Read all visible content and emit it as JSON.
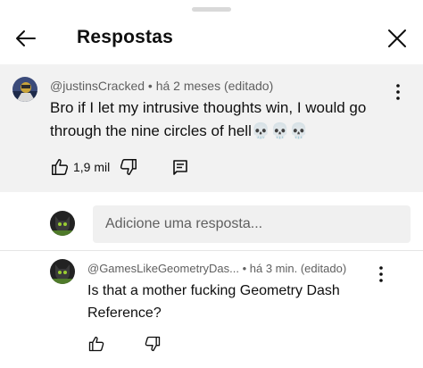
{
  "header": {
    "title": "Respostas"
  },
  "parent_comment": {
    "author": "@justinsCracked",
    "meta": " • há 2 meses (editado)",
    "text": "Bro if I let my intrusive thoughts win, I would go through the nine circles of hell💀💀💀",
    "likes": "1,9 mil"
  },
  "reply_input": {
    "placeholder": "Adicione uma resposta..."
  },
  "reply": {
    "author": "@GamesLikeGeometryDas...",
    "meta": " • há 3 min. (editado)",
    "text": "Is that a mother fucking Geometry Dash Reference?"
  },
  "icons": {
    "back": "arrow-left-icon",
    "close": "close-icon",
    "more": "more-vertical-icon",
    "like": "thumb-up-icon",
    "dislike": "thumb-down-icon",
    "reply": "comment-icon"
  }
}
